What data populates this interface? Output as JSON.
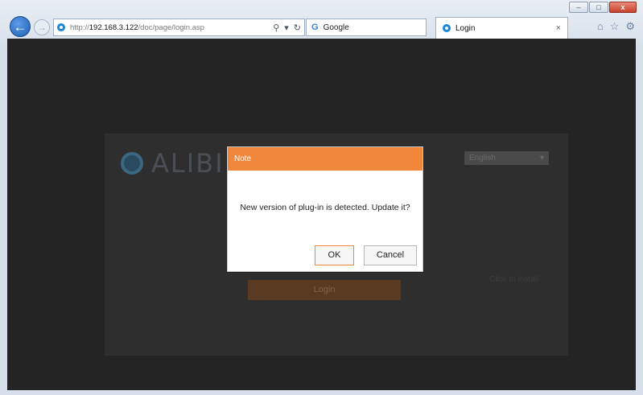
{
  "browser": {
    "window_controls": {
      "minimize": "–",
      "maximize": "□",
      "close": "x"
    },
    "back_glyph": "←",
    "forward_glyph": "→",
    "address": {
      "scheme": "http://",
      "host": "192.168.3.122",
      "path": "/doc/page/login.asp"
    },
    "address_tools": {
      "search": "⚲",
      "dropdown": "▾",
      "refresh": "↻"
    },
    "search_box": {
      "icon": "G",
      "text": "Google"
    },
    "tab": {
      "title": "Login",
      "close": "×"
    },
    "right_tools": {
      "home": "⌂",
      "favorites": "☆",
      "settings": "⚙"
    }
  },
  "page": {
    "logo_text": "ALIBI",
    "language": "English",
    "login_button": "Login",
    "faint_link": "Click to install"
  },
  "dialog": {
    "title": "Note",
    "message": "New version of plug-in is detected. Update it?",
    "ok_label": "OK",
    "cancel_label": "Cancel",
    "accent_color": "#f0873b"
  }
}
